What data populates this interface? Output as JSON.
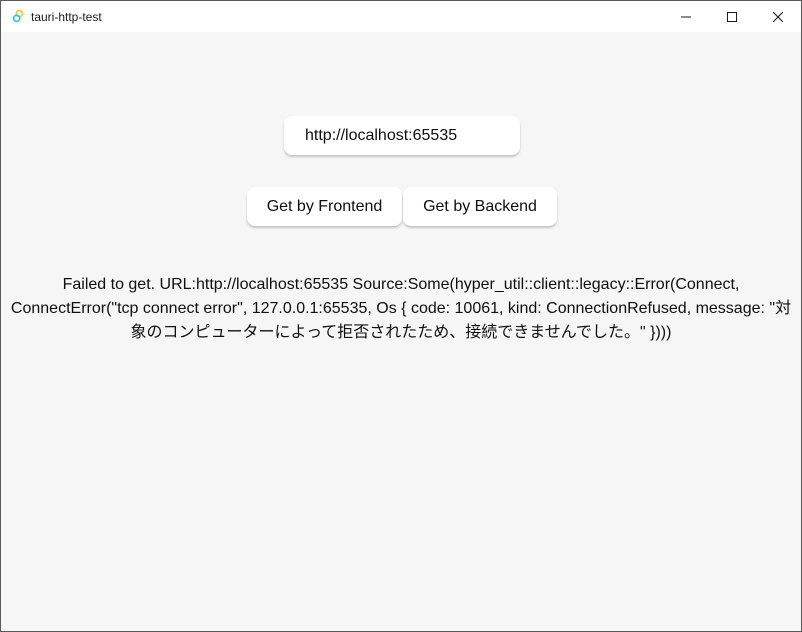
{
  "window": {
    "title": "tauri-http-test",
    "controls": {
      "minimize_icon": "minimize-icon",
      "maximize_icon": "maximize-icon",
      "close_icon": "close-icon"
    }
  },
  "form": {
    "url_value": "http://localhost:65535",
    "frontend_button_label": "Get by Frontend",
    "backend_button_label": "Get by Backend"
  },
  "result": {
    "message": "Failed to get. URL:http://localhost:65535 Source:Some(hyper_util::client::legacy::Error(Connect, ConnectError(\"tcp connect error\", 127.0.0.1:65535, Os { code: 10061, kind: ConnectionRefused, message: \"対象のコンピューターによって拒否されたため、接続できませんでした。\" })))"
  },
  "colors": {
    "background": "#f6f6f6",
    "titlebar": "#ffffff",
    "text": "#0f0f0f",
    "app_icon_primary": "#ffc131",
    "app_icon_secondary": "#24c8db"
  }
}
